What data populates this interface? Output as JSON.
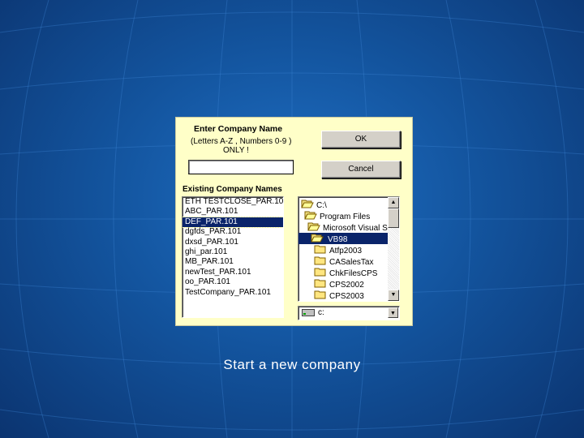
{
  "dialog": {
    "title": "Enter Company Name",
    "hint_line1": "(Letters A-Z , Numbers 0-9 )",
    "hint_line2": "ONLY !",
    "name_input_value": "",
    "ok_label": "OK",
    "cancel_label": "Cancel",
    "existing_label": "Existing Company Names",
    "companies": [
      "ETH TESTCLOSE_PAR.10",
      "ABC_PAR.101",
      "DEF_PAR.101",
      "dgfds_PAR.101",
      "dxsd_PAR.101",
      "ghi_par.101",
      "MB_PAR.101",
      "newTest_PAR.101",
      "oo_PAR.101",
      "TestCompany_PAR.101"
    ],
    "selected_company_index": 2,
    "directories": [
      {
        "label": "C:\\",
        "open": true,
        "level": 0
      },
      {
        "label": "Program Files",
        "open": true,
        "level": 1
      },
      {
        "label": "Microsoft Visual St",
        "open": true,
        "level": 2
      },
      {
        "label": "VB98",
        "open": true,
        "level": 3,
        "selected": true
      },
      {
        "label": "Atfp2003",
        "open": false,
        "level": 4
      },
      {
        "label": "CASalesTax",
        "open": false,
        "level": 4
      },
      {
        "label": "ChkFilesCPS",
        "open": false,
        "level": 4
      },
      {
        "label": "CPS2002",
        "open": false,
        "level": 4
      },
      {
        "label": "CPS2003",
        "open": false,
        "level": 4
      }
    ],
    "drive": "c:",
    "icons": {
      "folder": "folder-icon",
      "open_folder": "open-folder-icon",
      "drive": "drive-icon",
      "scroll_up": "scroll-up-arrow-icon",
      "scroll_down": "scroll-down-arrow-icon",
      "dropdown": "dropdown-arrow-icon"
    }
  },
  "caption": "Start a new company",
  "colors": {
    "background": "#13549e",
    "dialog_bg": "#ffffc8",
    "selection": "#0a246a"
  }
}
